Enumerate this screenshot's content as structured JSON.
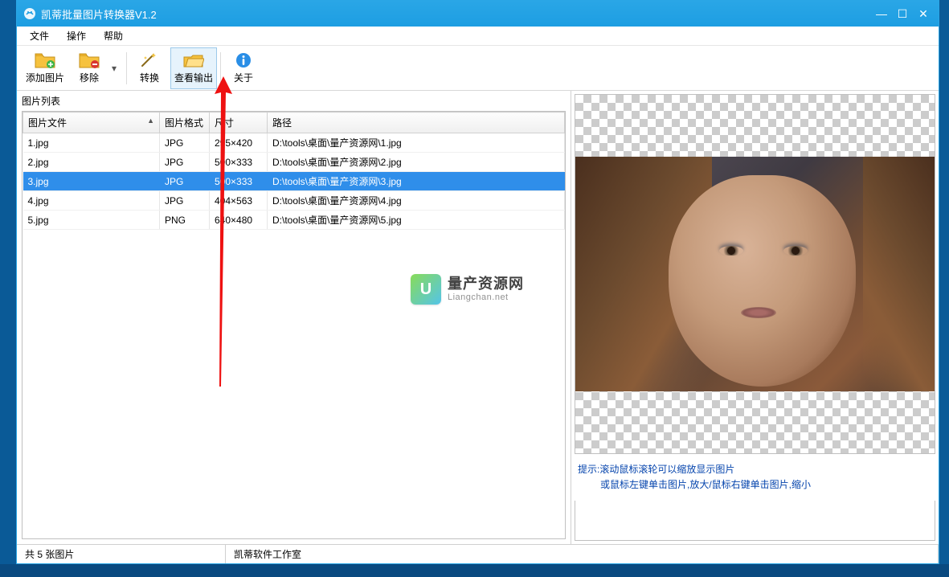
{
  "window": {
    "title": "凯蒂批量图片转换器V1.2"
  },
  "menu": {
    "file": "文件",
    "operate": "操作",
    "help": "帮助"
  },
  "toolbar": {
    "add": "添加图片",
    "remove": "移除",
    "convert": "转换",
    "view_output": "查看输出",
    "about": "关于"
  },
  "list": {
    "caption": "图片列表",
    "headers": {
      "file": "图片文件",
      "format": "图片格式",
      "size": "尺寸",
      "path": "路径"
    },
    "rows": [
      {
        "file": "1.jpg",
        "format": "JPG",
        "size": "295×420",
        "path": "D:\\tools\\桌面\\量产资源网\\1.jpg",
        "selected": false
      },
      {
        "file": "2.jpg",
        "format": "JPG",
        "size": "500×333",
        "path": "D:\\tools\\桌面\\量产资源网\\2.jpg",
        "selected": false
      },
      {
        "file": "3.jpg",
        "format": "JPG",
        "size": "500×333",
        "path": "D:\\tools\\桌面\\量产资源网\\3.jpg",
        "selected": true
      },
      {
        "file": "4.jpg",
        "format": "JPG",
        "size": "404×563",
        "path": "D:\\tools\\桌面\\量产资源网\\4.jpg",
        "selected": false
      },
      {
        "file": "5.jpg",
        "format": "PNG",
        "size": "640×480",
        "path": "D:\\tools\\桌面\\量产资源网\\5.jpg",
        "selected": false
      }
    ]
  },
  "tips": {
    "line1": "提示:滚动鼠标滚轮可以缩放显示图片",
    "line2": "或鼠标左键单击图片,放大/鼠标右键单击图片,缩小"
  },
  "status": {
    "count": "共 5 张图片",
    "studio": "凯蒂软件工作室"
  },
  "watermark": {
    "cn": "量产资源网",
    "en": "Liangchan.net"
  }
}
